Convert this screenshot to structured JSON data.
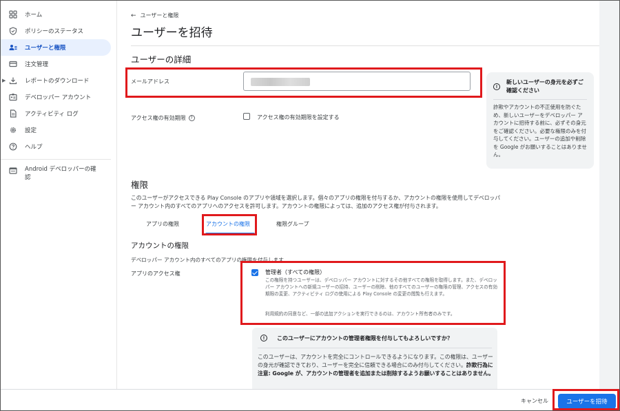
{
  "sidebar": {
    "items": [
      {
        "label": "ホーム",
        "icon": "grid-icon"
      },
      {
        "label": "ポリシーのステータス",
        "icon": "shield-icon"
      },
      {
        "label": "ユーザーと権限",
        "icon": "users-icon"
      },
      {
        "label": "注文管理",
        "icon": "credit-card-icon"
      },
      {
        "label": "レポートのダウンロード",
        "icon": "download-icon"
      },
      {
        "label": "デベロッパー アカウント",
        "icon": "badge-icon"
      },
      {
        "label": "アクティビティ ログ",
        "icon": "document-icon"
      },
      {
        "label": "設定",
        "icon": "gear-icon"
      },
      {
        "label": "ヘルプ",
        "icon": "help-icon"
      }
    ],
    "android_label": "Android デベロッパーの確認"
  },
  "header": {
    "back_label": "ユーザーと権限",
    "title": "ユーザーを招待"
  },
  "user_details": {
    "title": "ユーザーの詳細",
    "email_label": "メールアドレス",
    "expiry_label": "アクセス権の有効期限",
    "expiry_checkbox_label": "アクセス権の有効期限を設定する"
  },
  "info_card": {
    "title": "新しいユーザーの身元を必ずご確認ください",
    "body": "詐欺やアカウントの不正使用を防ぐため、新しいユーザーをデベロッパー アカウントに招待する前に、必ずその身元をご確認ください。必要な権限のみを付与してください。ユーザーの追加や削除を Google がお願いすることはありません。"
  },
  "permissions": {
    "title": "権限",
    "description": "このユーザーがアクセスできる Play Console のアプリや領域を選択します。個々のアプリの権限を付与するか、アカウントの権限を使用してデベロッパー アカウント内のすべてのアプリへのアクセスを許可します。アカウントの権限によっては、追加のアクセス権が付与されます。",
    "tabs": [
      "アプリの権限",
      "アカウントの権限",
      "権限グループ"
    ],
    "active_tab": 1
  },
  "account_permissions": {
    "title": "アカウントの権限",
    "description": "デベロッパー アカウント内のすべてのアプリの権限を付与します",
    "app_access_label": "アプリのアクセス権",
    "admin_title": "管理者（すべての権限）",
    "admin_desc": "この権限を持つユーザーは、デベロッパー アカウントに対するその他すべての権限を取得します。また、デベロッパー アカウントへの新規ユーザーの招待、ユーザーの削除、他のすべてのユーザーの権限の管理、アクセスの有効期限の変更、アクティビティ ログの使用による Play Console の変更の閲覧も行えます。",
    "admin_note": "利用規約の同意など、一部の追加アクションを実行できるのは、アカウント所有者のみです。",
    "admin_checked": true
  },
  "warning": {
    "title": "このユーザーにアカウントの管理者権限を付与してもよろしいですか？",
    "body_plain": "このユーザーは、アカウントを完全にコントロールできるようになります。この権限は、ユーザーの身元が確認できており、ユーザーを完全に信頼できる場合にのみ付与してください。",
    "body_bold": "詐欺行為に注意: Google が、アカウントの管理者を追加または削除するようお願いすることはありません。"
  },
  "footer": {
    "cancel_label": "キャンセル",
    "invite_label": "ユーザーを招待"
  },
  "colors": {
    "accent": "#1a73e8",
    "highlight": "#e0191c",
    "active_nav_bg": "#e8f0fe"
  }
}
